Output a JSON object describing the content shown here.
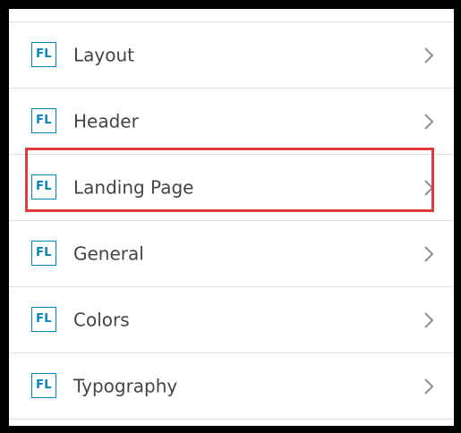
{
  "menu": {
    "items": [
      {
        "icon_text": "FL",
        "label": "Layout",
        "icon": "chevron-right-icon"
      },
      {
        "icon_text": "FL",
        "label": "Header",
        "icon": "chevron-right-icon"
      },
      {
        "icon_text": "FL",
        "label": "Landing Page",
        "icon": "chevron-right-icon",
        "highlighted": true
      },
      {
        "icon_text": "FL",
        "label": "General",
        "icon": "chevron-right-icon"
      },
      {
        "icon_text": "FL",
        "label": "Colors",
        "icon": "chevron-right-icon"
      },
      {
        "icon_text": "FL",
        "label": "Typography",
        "icon": "chevron-right-icon"
      }
    ]
  },
  "colors": {
    "badge": "#0085ba",
    "label": "#444444",
    "chevron": "#8c8f94",
    "divider": "#e2e2e2",
    "highlight": "#e03a3a",
    "outer_border": "#000000"
  }
}
